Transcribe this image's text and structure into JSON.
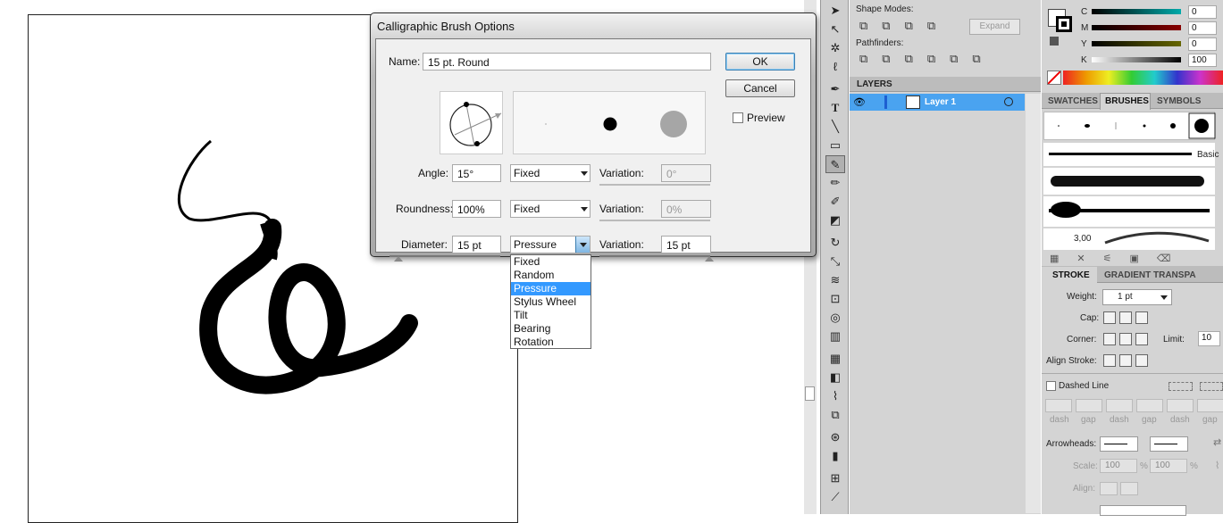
{
  "dialog": {
    "title": "Calligraphic Brush Options",
    "name_label": "Name:",
    "name_value": "15 pt. Round",
    "ok_label": "OK",
    "cancel_label": "Cancel",
    "preview_label": "Preview",
    "angle": {
      "label": "Angle:",
      "value": "15°",
      "mode": "Fixed",
      "variation_label": "Variation:",
      "variation_value": "0°"
    },
    "roundness": {
      "label": "Roundness:",
      "value": "100%",
      "mode": "Fixed",
      "variation_label": "Variation:",
      "variation_value": "0%"
    },
    "diameter": {
      "label": "Diameter:",
      "value": "15 pt",
      "mode": "Pressure",
      "variation_label": "Variation:",
      "variation_value": "15 pt"
    },
    "dropdown_options": [
      "Fixed",
      "Random",
      "Pressure",
      "Stylus Wheel",
      "Tilt",
      "Bearing",
      "Rotation"
    ],
    "selected_option": "Pressure"
  },
  "pathfinder": {
    "shape_modes_label": "Shape Modes:",
    "pathfinders_label": "Pathfinders:",
    "expand_label": "Expand"
  },
  "color": {
    "labels": [
      "C",
      "M",
      "Y",
      "K"
    ],
    "values": [
      "0",
      "0",
      "0",
      "100"
    ]
  },
  "layers": {
    "tab_label": "LAYERS",
    "layer_name": "Layer 1"
  },
  "brushes": {
    "tabs": [
      "SWATCHES",
      "BRUSHES",
      "SYMBOLS"
    ],
    "basic_label": "Basic",
    "size_label": "3,00"
  },
  "stroke": {
    "tabs": [
      "STROKE",
      "GRADIENT",
      "TRANSPA"
    ],
    "weight_label": "Weight:",
    "weight_value": "1 pt",
    "cap_label": "Cap:",
    "corner_label": "Corner:",
    "limit_label": "Limit:",
    "limit_value": "10",
    "align_label": "Align Stroke:",
    "dashed_label": "Dashed Line",
    "dash_labels": [
      "dash",
      "gap",
      "dash",
      "gap",
      "dash",
      "gap"
    ],
    "arrowheads_label": "Arrowheads:",
    "scale_label": "Scale:",
    "scale_values": [
      "100",
      "100"
    ],
    "percent": "%",
    "align_arrow_label": "Align:"
  }
}
